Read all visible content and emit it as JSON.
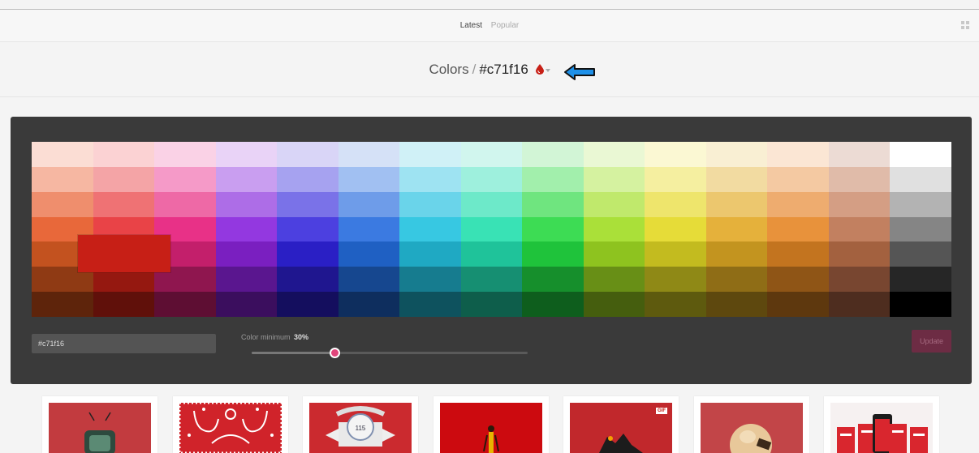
{
  "nav": {
    "latest": "Latest",
    "popular": "Popular"
  },
  "header": {
    "section": "Colors",
    "separator": "/",
    "hex": "#c71f16"
  },
  "palette": [
    [
      "#fbddd4",
      "#fbd2d3",
      "#fad2e6",
      "#e9d3f7",
      "#d9d5f7",
      "#d5e1f7",
      "#d0f1f7",
      "#d1f6ee",
      "#d2f5d6",
      "#eaf8d4",
      "#fbf8d3",
      "#f9efd3",
      "#fbe6d4",
      "#ecdbd4",
      "#ffffff"
    ],
    [
      "#f6b7a2",
      "#f4a4a6",
      "#f59ac8",
      "#c99ef0",
      "#a6a2f0",
      "#a1c0f2",
      "#9ee3f2",
      "#9ef0dd",
      "#a2efac",
      "#d5f2a0",
      "#f5efa0",
      "#f2dba1",
      "#f4c9a2",
      "#e0bba9",
      "#e0e0e0"
    ],
    [
      "#ef8e6d",
      "#ef7274",
      "#ee69a6",
      "#ad6de7",
      "#7a72e8",
      "#6e9ce9",
      "#6ad4ea",
      "#6de9c9",
      "#6fe57f",
      "#c0e96c",
      "#eee56c",
      "#ecc76e",
      "#eeac6f",
      "#d49e84",
      "#b3b3b3"
    ],
    [
      "#e8683a",
      "#e94347",
      "#e83187",
      "#9338e0",
      "#4c40e0",
      "#3b7ae1",
      "#37c8e2",
      "#39e2b5",
      "#3ddc54",
      "#aae039",
      "#e6dc38",
      "#e5b13b",
      "#e8923b",
      "#c28060",
      "#858585"
    ],
    [
      "#c3521f",
      "#c71f16",
      "#c31f6b",
      "#7a1fc0",
      "#2a1fc5",
      "#1f60c3",
      "#1fa9c3",
      "#1fc39a",
      "#1fc33b",
      "#8ec31f",
      "#c3bb1f",
      "#c3941f",
      "#c3741f",
      "#a3613f",
      "#555555"
    ],
    [
      "#8f3a14",
      "#951810",
      "#8f164f",
      "#5a168f",
      "#1f168f",
      "#16478f",
      "#167c8f",
      "#168f72",
      "#168f2c",
      "#688f16",
      "#8f8916",
      "#8f6d16",
      "#8f5516",
      "#784630",
      "#262626"
    ],
    [
      "#5e240b",
      "#60100a",
      "#5e0e33",
      "#3b0e5e",
      "#140e5e",
      "#0e2e5e",
      "#0e525e",
      "#0e5e4b",
      "#0e5e1d",
      "#455e0e",
      "#5e5a0e",
      "#5e480e",
      "#5e380e",
      "#4e2d1f",
      "#000000"
    ]
  ],
  "picker": {
    "hex_value": "#c71f16",
    "minimum_label": "Color minimum",
    "minimum_value": "30%",
    "minimum_fraction": 0.3,
    "update_label": "Update"
  },
  "thumbnails": [
    {
      "color": "#c23b3f",
      "subject": "tv"
    },
    {
      "color": "#d0232a",
      "subject": "pattern"
    },
    {
      "color": "#cb2a2f",
      "subject": "badge"
    },
    {
      "color": "#cc0a0f",
      "subject": "figure"
    },
    {
      "color": "#c1282c",
      "subject": "scene",
      "badge": "GIF"
    },
    {
      "color": "#c24548",
      "subject": "character"
    },
    {
      "color": "#f6f1f1",
      "subject": "phone"
    }
  ],
  "colors": {
    "accent": "#e0457b",
    "panel": "#3a3a3a",
    "arrow": "#1e90e8"
  }
}
